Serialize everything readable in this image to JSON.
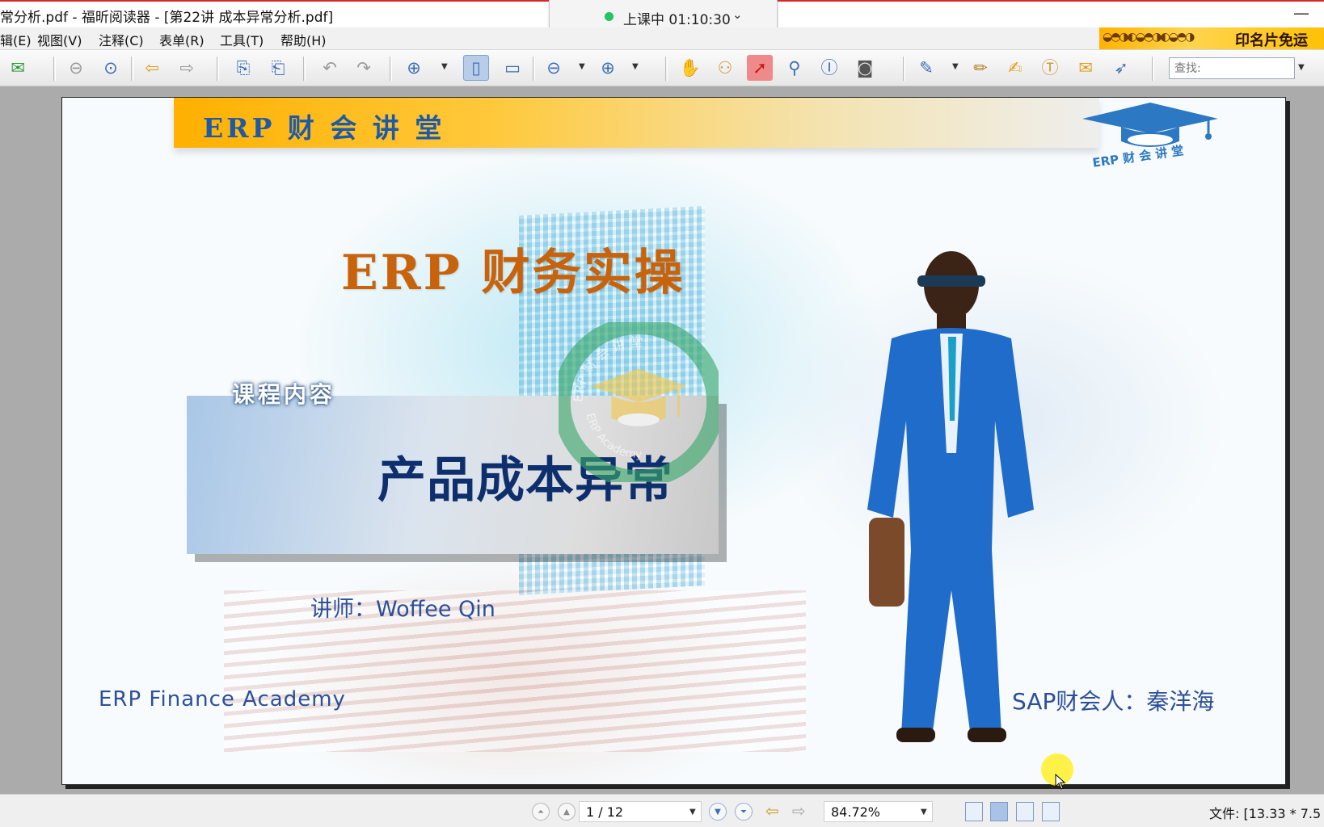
{
  "window": {
    "title": "常分析.pdf - 福昕阅读器 - [第22讲 成本异常分析.pdf]",
    "minimize_glyph": "—"
  },
  "class_status": {
    "text": "上课中 01:10:30",
    "indicator_color": "#22c55e"
  },
  "menu": {
    "items": [
      "辑(E)",
      "视图(V)",
      "注释(C)",
      "表单(R)",
      "工具(T)",
      "帮助(H)"
    ]
  },
  "ad_banner": {
    "text": "印名片免运"
  },
  "toolbar": {
    "search_placeholder": "查找:"
  },
  "slide": {
    "header_text": "ERP 财 会 讲 堂",
    "logo_text": "ERP 财 会 讲 堂",
    "main_title": "ERP 财务实操",
    "content_label": "课程内容",
    "course_name": "产品成本异常",
    "lecturer": "讲师：Woffee Qin",
    "academy": "ERP  Finance  Academy",
    "author": "SAP财会人：秦洋海",
    "seal_text_top": "ERP 财 会 讲 堂",
    "seal_text_bottom": "ERP Academy",
    "colors": {
      "header_gold": "#ffb000",
      "title_orange": "#c8630c",
      "course_navy": "#0e2f6e",
      "text_blue": "#2d4f9a",
      "seal_green": "#3aa86b"
    }
  },
  "statusbar": {
    "page_indicator": "1 / 12",
    "zoom": "84.72%",
    "file_info": "文件: [13.33 * 7.5"
  }
}
